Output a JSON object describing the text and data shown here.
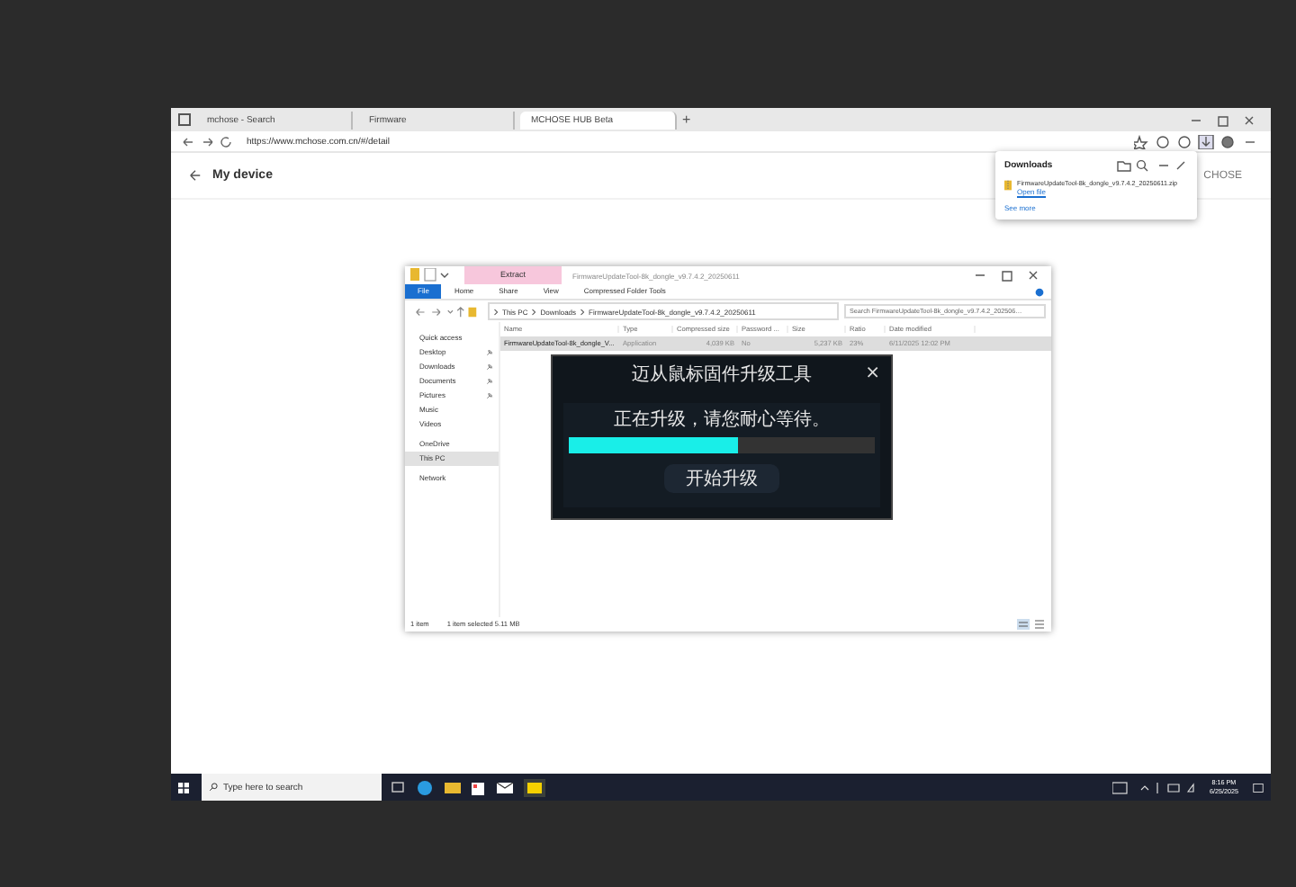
{
  "browser": {
    "tabs": [
      {
        "label": "mchose - Search",
        "selected": false
      },
      {
        "label": "Firmware",
        "selected": false
      },
      {
        "label": "MCHOSE HUB Beta",
        "selected": true
      }
    ],
    "new_tab": "+",
    "address": "https://www.mchose.com.cn/#/detail",
    "page_title": "My device",
    "brand": "CHOSE"
  },
  "downloads": {
    "title": "Downloads",
    "file": "FirmwareUpdateTool-8k_dongle_v9.7.4.2_20250611.zip",
    "open_link": "Open file",
    "see_more": "See more"
  },
  "explorer": {
    "title": "FirmwareUpdateTool-8k_dongle_v9.7.4.2_20250611",
    "context_tab": "Extract",
    "ribbon_tabs": [
      {
        "label": "File",
        "selected": true
      },
      {
        "label": "Home",
        "selected": false
      },
      {
        "label": "Share",
        "selected": false
      },
      {
        "label": "View",
        "selected": false
      },
      {
        "label": "Compressed Folder Tools",
        "selected": false
      }
    ],
    "path": [
      "This PC",
      "Downloads",
      "FirmwareUpdateTool-8k_dongle_v9.7.4.2_20250611"
    ],
    "search": {
      "placeholder": "Search FirmwareUpdateTool-8k_dongle_v9.7.4.2_202506…"
    },
    "nav": [
      {
        "label": "Quick access",
        "pinned": false,
        "selected": false
      },
      {
        "label": "Desktop",
        "pinned": true,
        "selected": false
      },
      {
        "label": "Downloads",
        "pinned": true,
        "selected": false
      },
      {
        "label": "Documents",
        "pinned": true,
        "selected": false
      },
      {
        "label": "Pictures",
        "pinned": true,
        "selected": false
      },
      {
        "label": "Music",
        "pinned": false,
        "selected": false
      },
      {
        "label": "Videos",
        "pinned": false,
        "selected": false
      },
      {
        "label": "OneDrive",
        "pinned": false,
        "selected": false
      },
      {
        "label": "This PC",
        "pinned": false,
        "selected": true
      },
      {
        "label": "Network",
        "pinned": false,
        "selected": false
      }
    ],
    "columns": [
      "Name",
      "Type",
      "Compressed size",
      "Password ...",
      "Size",
      "Ratio",
      "Date modified"
    ],
    "rows": [
      {
        "cells": [
          "FirmwareUpdateTool-8k_dongle_V...",
          "Application",
          "4,039 KB",
          "No",
          "5,237 KB",
          "23%",
          "6/11/2025 12:02 PM"
        ],
        "selected": true
      }
    ],
    "status": [
      "1 item",
      "1 item selected 5.11 MB"
    ]
  },
  "dialog": {
    "title": "迈从鼠标固件升级工具",
    "close": "×",
    "message": "正在升级，请您耐心等待。",
    "level": 0.55,
    "button": "开始升级"
  },
  "taskbar": {
    "search_placeholder": "Type here to search",
    "time": "8:16 PM",
    "date": "6/25/2025"
  }
}
